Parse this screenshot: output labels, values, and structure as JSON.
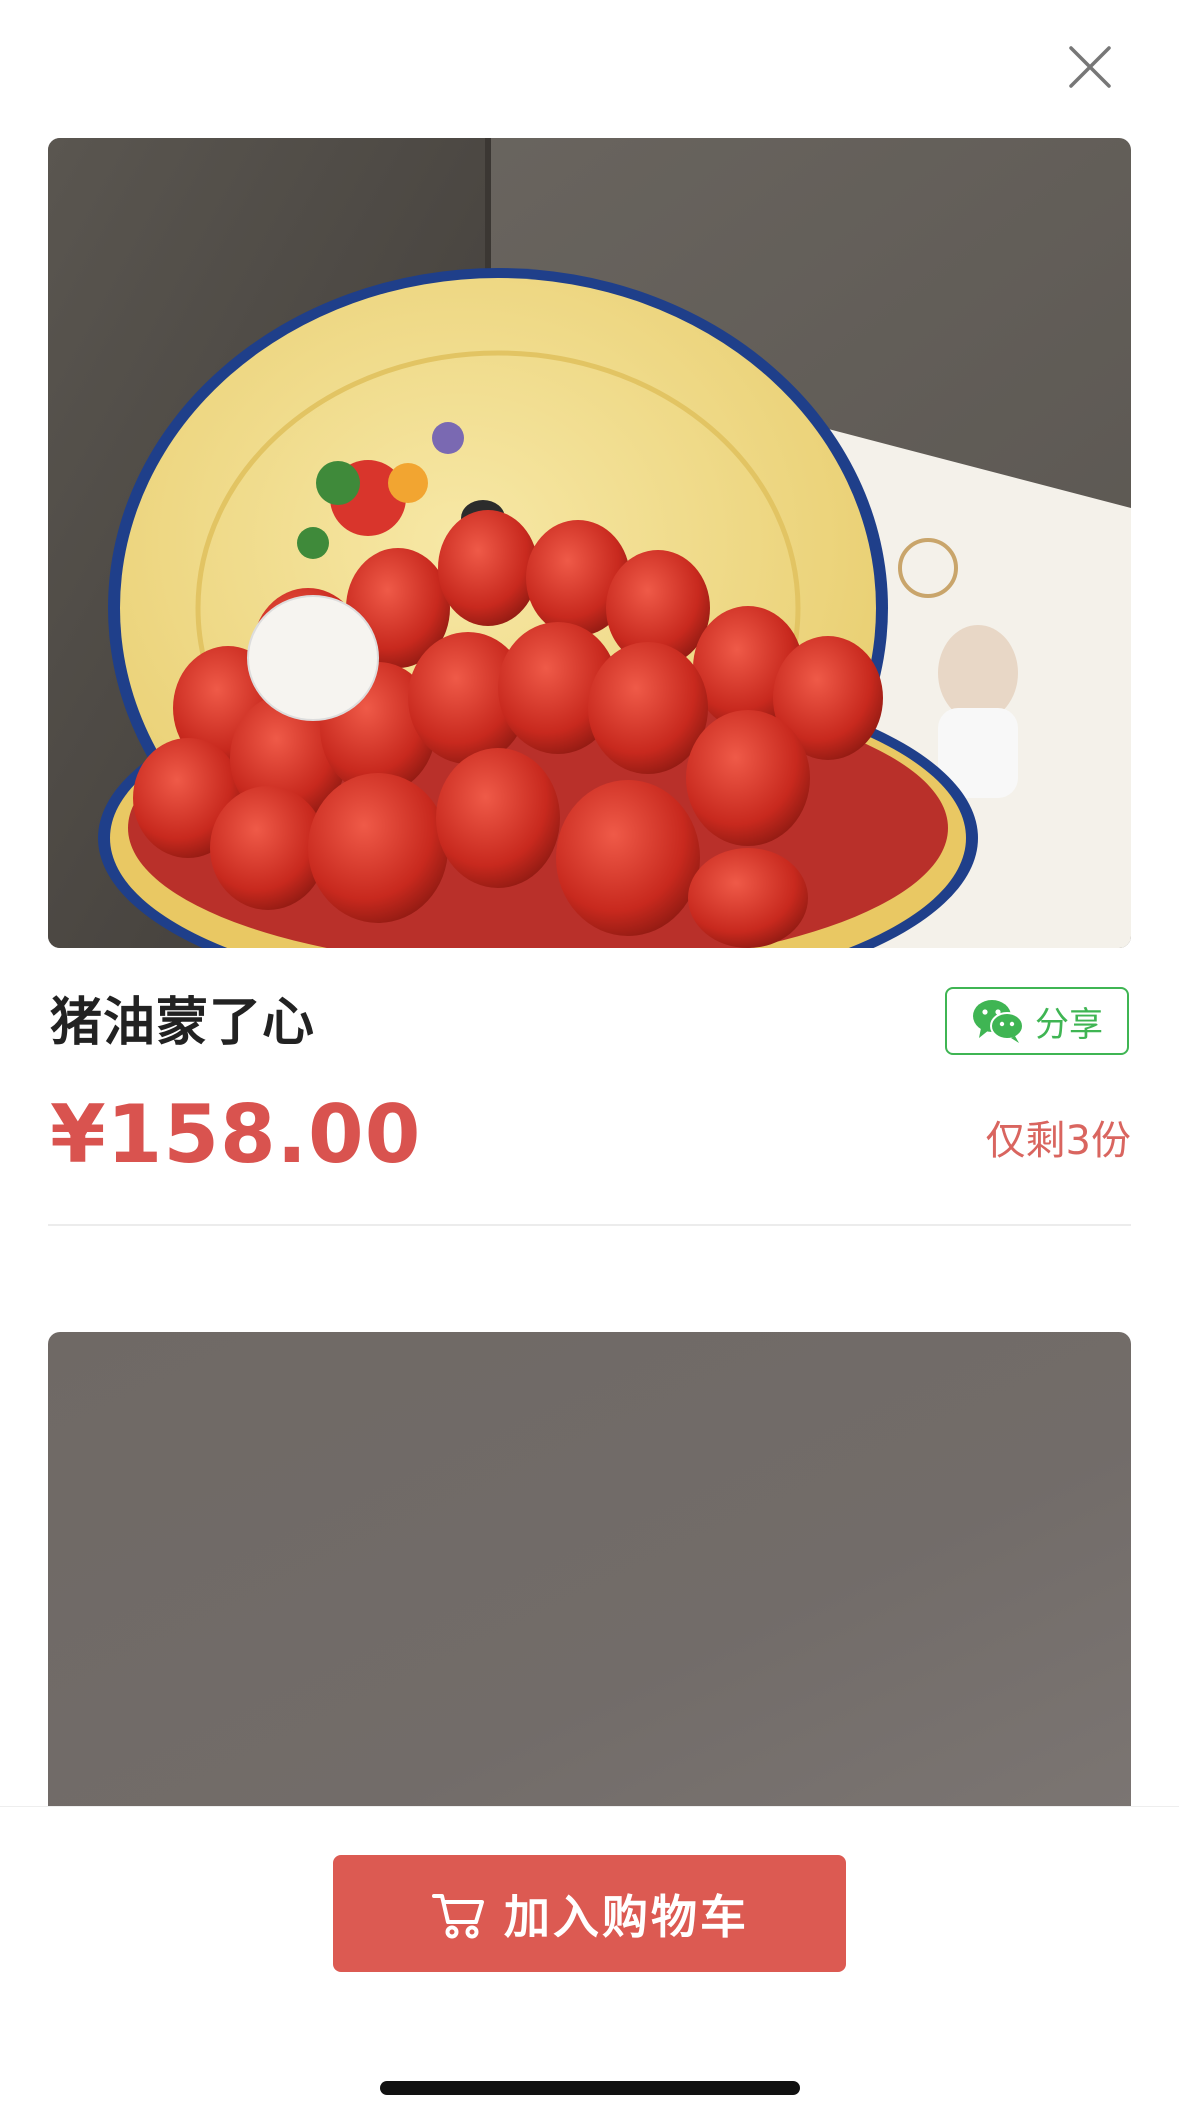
{
  "product": {
    "title": "猪油蒙了心",
    "price": "¥158.00",
    "stock_text": "仅剩3份",
    "share_label": "分享",
    "images": [
      "strawberry-cake-photo",
      "gray-background-photo"
    ]
  },
  "actions": {
    "add_to_cart_label": "加入购物车"
  },
  "colors": {
    "accent": "#dc5a52",
    "price": "#d9534f",
    "share_green": "#3fb553"
  },
  "icons": {
    "close": "close-icon",
    "share": "wechat-icon",
    "cart": "cart-icon"
  }
}
